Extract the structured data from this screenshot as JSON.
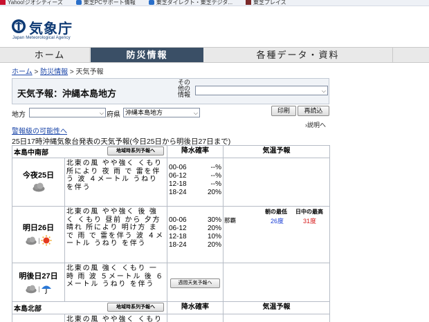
{
  "favorites": [
    "Yahoo!ジオシティーズ",
    "東芝PCサポート情報",
    "東芝ダイレクト・東芝デジタ...",
    "東芝プレイス"
  ],
  "brand": {
    "name": "気象庁",
    "english": "Japan Meteorological Agency"
  },
  "gnav": [
    "ホーム",
    "防災情報",
    "各種データ・資料"
  ],
  "breadcrumb": {
    "home": "ホーム",
    "bousai": "防災情報",
    "current": "天気予報",
    "sep": ">"
  },
  "title": "天気予報：沖縄本島地方",
  "other_info_label": "その他の情報",
  "other_info_value": "",
  "region": {
    "chihou_label": "地方",
    "chihou_value": "",
    "fuken_label": "府県",
    "fuken_value": "沖縄本島地方"
  },
  "buttons": {
    "print": "印刷",
    "reload": "再読込",
    "explain": "説明へ"
  },
  "warning_link": "警報級の可能性へ",
  "announce": "25日17時沖縄気象台発表の天気予報(今日25日から明後日27日まで)",
  "columns": {
    "rain": "降水確率",
    "temp": "気温予報"
  },
  "areas": [
    {
      "name": "本島中南部",
      "timeseries_button": "地域時系列予報へ",
      "days": [
        {
          "label": "今夜25日",
          "icons": [
            "cloud"
          ],
          "text": "北東の風 やや強く くもり 所により 夜 雨 で 雷を伴う 波 ４メートル うねり を伴う",
          "rain": [
            [
              "00-06",
              "--%"
            ],
            [
              "06-12",
              "--%"
            ],
            [
              "12-18",
              "--%"
            ],
            [
              "18-24",
              "20%"
            ]
          ]
        },
        {
          "label": "明日26日",
          "icons": [
            "cloud",
            "sun"
          ],
          "text": "北東の風 やや強く 後 強く くもり 昼前 から 夕方 晴れ 所により 明け方 まで 雨 で 雷を伴う 波 ４メートル うねり を伴う",
          "rain": [
            [
              "00-06",
              "30%"
            ],
            [
              "06-12",
              "20%"
            ],
            [
              "12-18",
              "10%"
            ],
            [
              "18-24",
              "20%"
            ]
          ],
          "temp": {
            "min_label": "朝の最低",
            "max_label": "日中の最高",
            "station": "那覇",
            "min": "26度",
            "max": "31度"
          }
        },
        {
          "label": "明後日27日",
          "icons": [
            "cloud",
            "umbrella"
          ],
          "text": "北東の風 強く くもり 一時 雨 波 ５メートル 後 ６メートル うねり を伴う",
          "weekly_button": "週間天気予報へ"
        }
      ]
    },
    {
      "name": "本島北部",
      "timeseries_button": "地域時系列予報へ",
      "partial_text": "北東の風 やや強く くもり"
    }
  ]
}
